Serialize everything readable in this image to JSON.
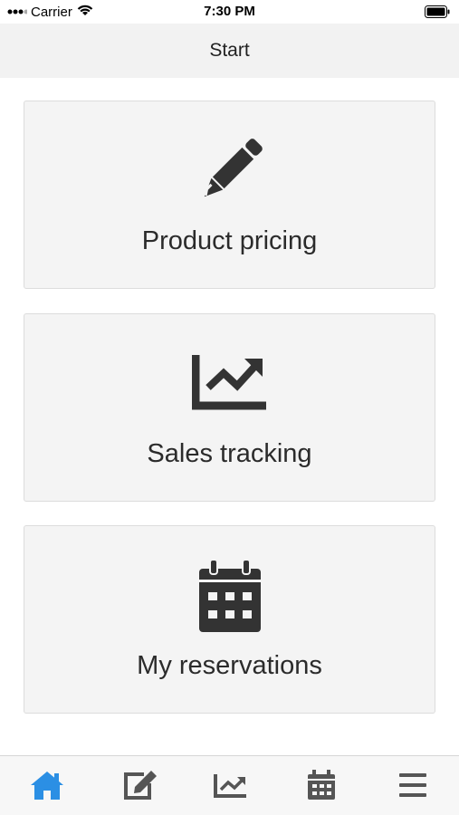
{
  "status_bar": {
    "carrier": "Carrier",
    "time": "7:30 PM"
  },
  "nav": {
    "title": "Start"
  },
  "cards": [
    {
      "label": "Product pricing",
      "icon": "pencil-icon"
    },
    {
      "label": "Sales tracking",
      "icon": "line-chart-icon"
    },
    {
      "label": "My reservations",
      "icon": "calendar-icon"
    }
  ],
  "tab_bar": {
    "active_color": "#2b8fe4",
    "inactive_color": "#555555",
    "items": [
      {
        "icon": "home-icon",
        "active": true
      },
      {
        "icon": "edit-icon",
        "active": false
      },
      {
        "icon": "line-chart-icon",
        "active": false
      },
      {
        "icon": "calendar-icon",
        "active": false
      },
      {
        "icon": "menu-icon",
        "active": false
      }
    ]
  }
}
